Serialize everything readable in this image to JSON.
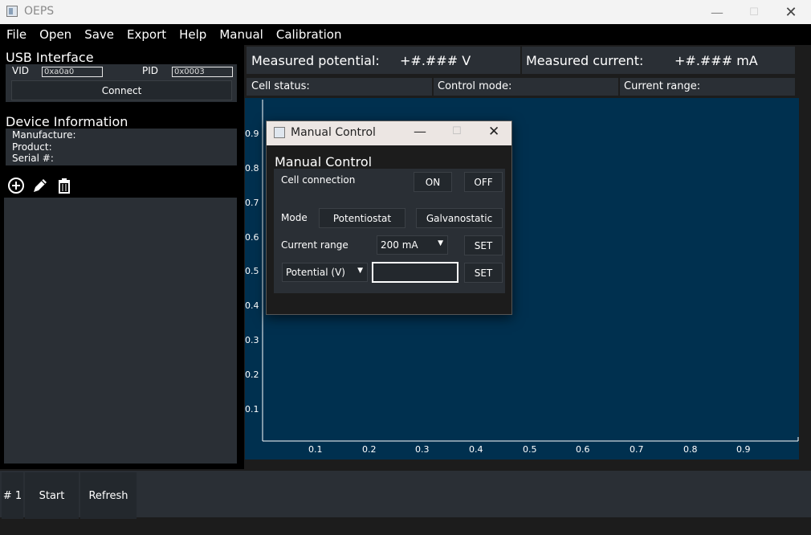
{
  "window": {
    "title": "OEPS"
  },
  "menu": [
    "File",
    "Open",
    "Save",
    "Export",
    "Help",
    "Manual",
    "Calibration"
  ],
  "usb": {
    "title": "USB Interface",
    "vid_label": "VID",
    "vid_value": "0xa0a0",
    "pid_label": "PID",
    "pid_value": "0x0003",
    "connect": "Connect"
  },
  "device": {
    "title": "Device Information",
    "manufacture": "Manufacture:",
    "product": "Product:",
    "serial": "Serial #:"
  },
  "measure": {
    "potential_label": "Measured potential:",
    "potential_value": "+#.### V",
    "current_label": "Measured current:",
    "current_value": "+#.### mA"
  },
  "status": {
    "cell": "Cell status:",
    "mode": "Control mode:",
    "range": "Current range:"
  },
  "plot": {
    "y_ticks": [
      "0.9",
      "0.8",
      "0.7",
      "0.6",
      "0.5",
      "0.4",
      "0.3",
      "0.2",
      "0.1"
    ],
    "x_ticks": [
      "0.1",
      "0.2",
      "0.3",
      "0.4",
      "0.5",
      "0.6",
      "0.7",
      "0.8",
      "0.9"
    ]
  },
  "bottom": {
    "index": "# 1",
    "start": "Start",
    "refresh": "Refresh"
  },
  "dialog": {
    "title": "Manual Control",
    "heading": "Manual Control",
    "cell_connection": "Cell connection",
    "on": "ON",
    "off": "OFF",
    "mode": "Mode",
    "potentiostat": "Potentiostat",
    "galvanostatic": "Galvanostatic",
    "current_range": "Current range",
    "range_value": "200 mA",
    "set": "SET",
    "setpoint_select": "Potential (V)",
    "setpoint_value": ""
  },
  "colors": {
    "plot_bg": "#00304f",
    "panel": "#2a2f35"
  }
}
